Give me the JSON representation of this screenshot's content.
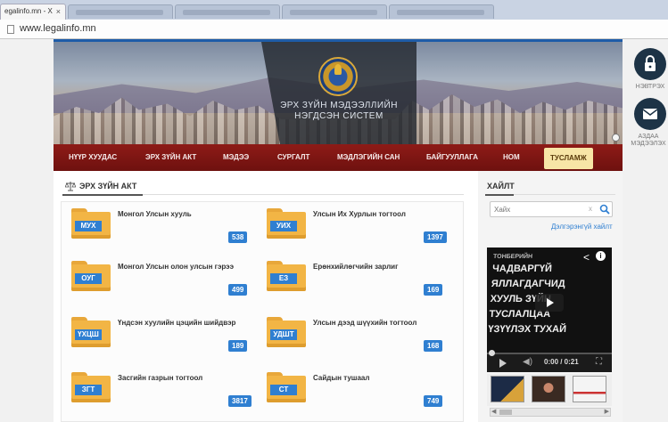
{
  "browser": {
    "tab_title": "egalinfo.mn - X",
    "tab_close": "×",
    "url": "www.legalinfo.mn"
  },
  "header": {
    "site_title_line1": "ЭРХ ЗҮЙН МЭДЭЭЛЛИЙН",
    "site_title_line2": "НЭГДСЭН СИСТЕМ"
  },
  "nav": {
    "items": [
      {
        "label": "НҮҮР ХУУДАС"
      },
      {
        "label": "ЭРХ ЗҮЙН АКТ"
      },
      {
        "label": "МЭДЭЭ"
      },
      {
        "label": "СУРГАЛТ"
      },
      {
        "label": "МЭДЛЭГИЙН САН"
      },
      {
        "label": "БАЙГУУЛЛАГА"
      },
      {
        "label": "НОМ"
      },
      {
        "label": "ТУСЛАМЖ",
        "active": true
      }
    ]
  },
  "main": {
    "section_title": "ЭРХ ЗҮЙН АКТ",
    "categories": [
      {
        "abbr": "МУХ",
        "name": "Монгол Улсын хууль",
        "count": "538"
      },
      {
        "abbr": "УИХ",
        "name": "Улсын Их Хурлын тогтоол",
        "count": "1397"
      },
      {
        "abbr": "ОУГ",
        "name": "Монгол Улсын олон улсын гэрээ",
        "count": "499"
      },
      {
        "abbr": "ЕЗ",
        "name": "Ерөнхийлөгчийн зарлиг",
        "count": "169"
      },
      {
        "abbr": "ҮХЦШ",
        "name": "Үндсэн хуулийн цэцийн шийдвэр",
        "count": "189"
      },
      {
        "abbr": "УДШТ",
        "name": "Улсын дээд шүүхийн тогтоол",
        "count": "168"
      },
      {
        "abbr": "ЗГТ",
        "name": "Засгийн газрын тогтоол",
        "count": "3817"
      },
      {
        "abbr": "СТ",
        "name": "Сайдын тушаал",
        "count": "749"
      }
    ]
  },
  "sidebar": {
    "search_title": "ХАЙЛТ",
    "search_placeholder": "Хайх",
    "search_clear": "x",
    "advanced_link": "Дэлгэрэнгүй хайлт",
    "video": {
      "text_small": "ТОНБЕРИЙН",
      "text_lines": [
        "ЧАДВАРГҮЙ",
        "ЯЛЛАГДАГЧИД",
        "ХУУЛЬ ЗҮЙН",
        "ТУСЛАЛЦАА",
        "ҮЗҮҮЛЭХ ТУХАЙ"
      ],
      "time": "0:00 / 0:21"
    }
  },
  "floating": {
    "login_label": "НЭВТРЭХ",
    "notify_label": "АЗДАА МЭДЭЭЛЭХ"
  },
  "colors": {
    "nav_bg": "#7b1512",
    "nav_active_bg": "#f7e5a6",
    "accent_blue": "#2f7fd1",
    "folder": "#f2b545",
    "header_line": "#1e5ca8"
  }
}
